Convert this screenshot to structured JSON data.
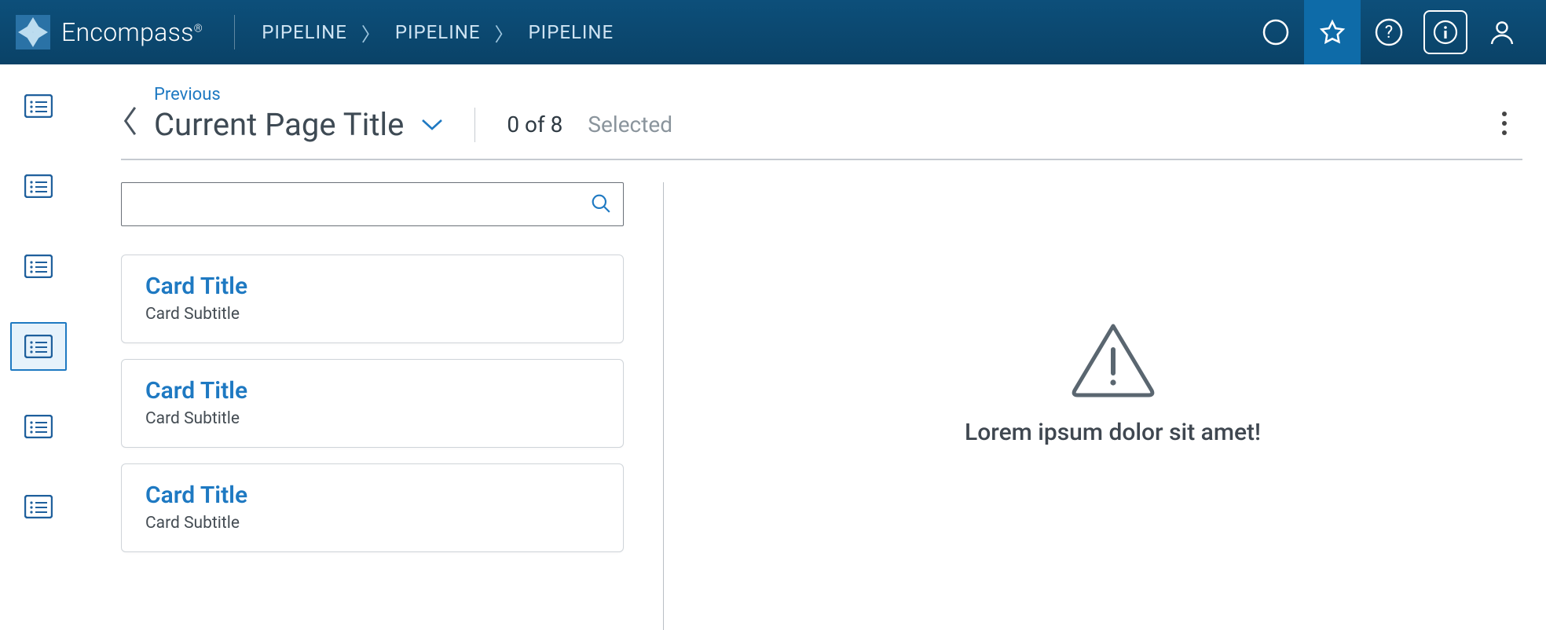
{
  "header": {
    "brand_name": "Encompass",
    "breadcrumb": [
      "PIPELINE",
      "PIPELINE",
      "PIPELINE"
    ]
  },
  "page": {
    "previous_label": "Previous",
    "title": "Current Page Title",
    "count_text": "0 of 8",
    "selected_label": "Selected"
  },
  "search": {
    "placeholder": ""
  },
  "cards": [
    {
      "title": "Card Title",
      "subtitle": "Card Subtitle"
    },
    {
      "title": "Card Title",
      "subtitle": "Card Subtitle"
    },
    {
      "title": "Card Title",
      "subtitle": "Card Subtitle"
    }
  ],
  "empty": {
    "message": "Lorem ipsum dolor sit amet!"
  },
  "sidenav_count": 6,
  "sidenav_active_index": 3
}
